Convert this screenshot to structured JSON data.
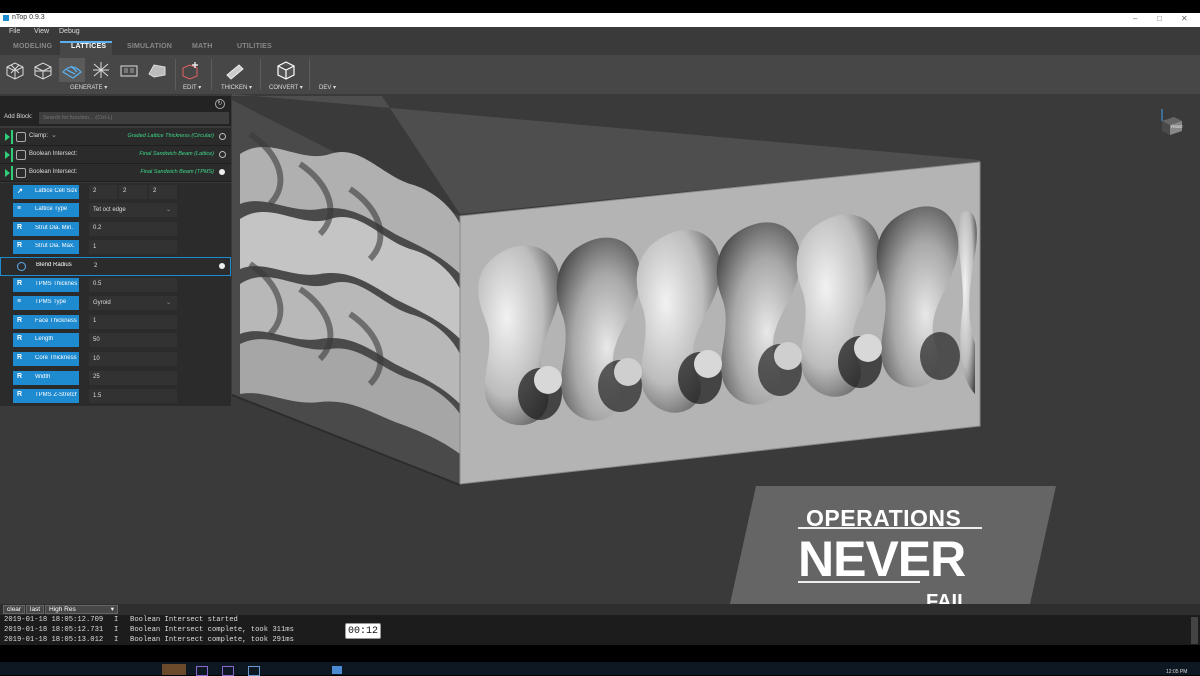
{
  "app": {
    "title": "nTop 0.9.3"
  },
  "menu": [
    "File",
    "View",
    "Debug"
  ],
  "tabs": [
    "MODELING",
    "LATTICES",
    "SIMULATION",
    "MATH",
    "UTILITIES"
  ],
  "active_tab": "LATTICES",
  "ribbon_groups": {
    "generate": "GENERATE",
    "edit": "EDIT",
    "thicken": "THICKEN",
    "convert": "CONVERT",
    "dev": "DEV"
  },
  "panel": {
    "add_block_label": "Add Block:",
    "search_placeholder": "Search for function... (Ctrl-L)",
    "blocks": [
      {
        "label": "Clamp:",
        "result": "Graded Lattice Thickness (Circular)",
        "active": false
      },
      {
        "label": "Boolean Intersect:",
        "result": "Final Sandwich Beam (Lattice)",
        "active": false
      },
      {
        "label": "Boolean Intersect:",
        "result": "Final Sandwich Beam (TPMS)",
        "active": true
      }
    ],
    "params": [
      {
        "icon": "vector-icon",
        "label": "Lattice Cell Size",
        "values": [
          "2",
          "2",
          "2"
        ]
      },
      {
        "icon": "list-icon",
        "label": "Lattice Type",
        "value": "Tet oct edge",
        "dropdown": true
      },
      {
        "icon": "real-icon",
        "label": "Strut Dia. Min.",
        "value": "0.2"
      },
      {
        "icon": "real-icon",
        "label": "Strut Dia. Max.",
        "value": "1"
      },
      {
        "icon": "sphere-icon",
        "label": "Blend Radius",
        "value": "2",
        "selected": true
      },
      {
        "icon": "real-icon",
        "label": "TPMS Thickness",
        "value": "0.5"
      },
      {
        "icon": "list-icon",
        "label": "TPMS Type",
        "value": "Gyroid",
        "dropdown": true
      },
      {
        "icon": "real-icon",
        "label": "Face Thickness",
        "value": "1"
      },
      {
        "icon": "real-icon",
        "label": "Length",
        "value": "50"
      },
      {
        "icon": "real-icon",
        "label": "Core Thickness",
        "value": "10"
      },
      {
        "icon": "real-icon",
        "label": "Width",
        "value": "25"
      },
      {
        "icon": "real-icon",
        "label": "TPMS Z-Stretch",
        "value": "1.5"
      }
    ]
  },
  "nav_cube_label": "FRONT",
  "overlay": {
    "line1": "OPERATIONS",
    "line2": "NEVER",
    "line3": "FAIL"
  },
  "console": {
    "buttons": [
      "clear",
      "last"
    ],
    "quality": "High Res",
    "logs": [
      {
        "time": "2019-01-18 18:05:12.709",
        "level": "I",
        "msg": "Boolean Intersect started"
      },
      {
        "time": "2019-01-18 18:05:12.731",
        "level": "I",
        "msg": "Boolean Intersect complete, took 311ms"
      },
      {
        "time": "2019-01-18 18:05:13.012",
        "level": "I",
        "msg": "Boolean Intersect complete, took 291ms"
      }
    ]
  },
  "video_time": "00:12",
  "clock": "12:05 PM",
  "colors": {
    "accent": "#1e8acf",
    "green": "#2fcf7a",
    "tab_active": "#5ab0ee"
  }
}
